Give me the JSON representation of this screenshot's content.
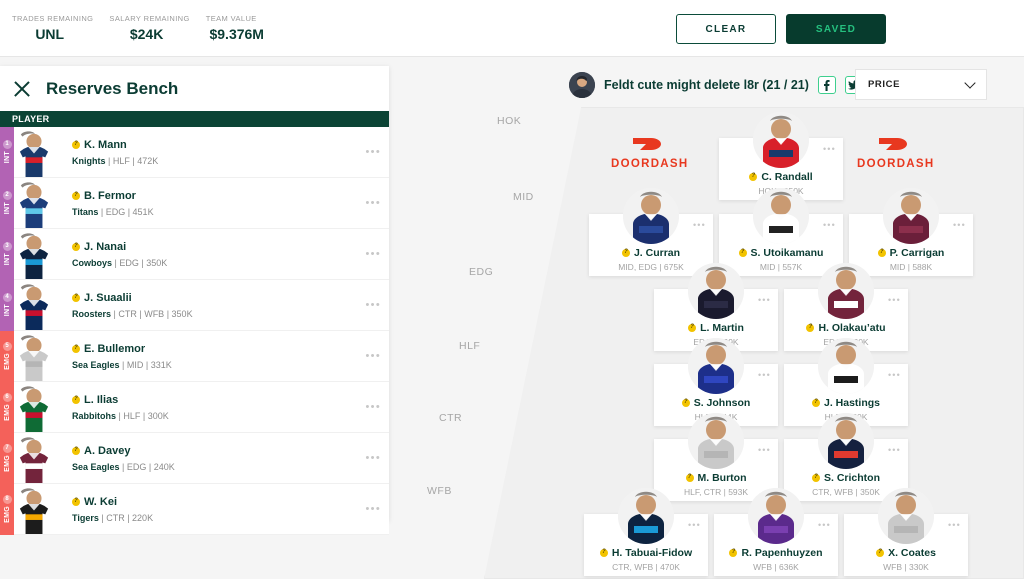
{
  "topbar": {
    "stats": [
      {
        "label": "TRADES REMAINING",
        "value": "UNL"
      },
      {
        "label": "SALARY REMAINING",
        "value": "$24K"
      },
      {
        "label": "TEAM VALUE",
        "value": "$9.376M"
      }
    ],
    "clear_label": "CLEAR",
    "saved_label": "SAVED"
  },
  "panel": {
    "title": "Reserves Bench",
    "close_icon": "close-icon",
    "column_header": "PLAYER",
    "rows": [
      {
        "slot": "INT",
        "num": "1",
        "name": "K. Mann",
        "club": "Knights",
        "pos": "HLF",
        "price": "472K",
        "jersey": [
          "#1a3a6b",
          "#d8202a"
        ],
        "menu": "•••"
      },
      {
        "slot": "INT",
        "num": "2",
        "name": "B. Fermor",
        "club": "Titans",
        "pos": "EDG",
        "price": "451K",
        "jersey": [
          "#1c3d7a",
          "#5fc8e8"
        ],
        "menu": "•••"
      },
      {
        "slot": "INT",
        "num": "3",
        "name": "J. Nanai",
        "club": "Cowboys",
        "pos": "EDG",
        "price": "350K",
        "jersey": [
          "#0d2340",
          "#1a9ad6"
        ],
        "menu": "•••"
      },
      {
        "slot": "INT",
        "num": "4",
        "name": "J. Suaalii",
        "club": "Roosters",
        "pos": "CTR | WFB",
        "price": "350K",
        "jersey": [
          "#0b2a5b",
          "#c8102e"
        ],
        "menu": "•••"
      },
      {
        "slot": "EMG",
        "num": "5",
        "name": "E. Bullemor",
        "club": "Sea Eagles",
        "pos": "MID",
        "price": "331K",
        "jersey": [
          "#c9c9c9",
          "#b5b5b5"
        ],
        "menu": "•••"
      },
      {
        "slot": "EMG",
        "num": "6",
        "name": "L. Ilias",
        "club": "Rabbitohs",
        "pos": "HLF",
        "price": "300K",
        "jersey": [
          "#0f6b35",
          "#c8102e"
        ],
        "menu": "•••"
      },
      {
        "slot": "EMG",
        "num": "7",
        "name": "A. Davey",
        "club": "Sea Eagles",
        "pos": "EDG",
        "price": "240K",
        "jersey": [
          "#73243c",
          "#ffffff"
        ],
        "menu": "•••"
      },
      {
        "slot": "EMG",
        "num": "8",
        "name": "W. Kei",
        "club": "Tigers",
        "pos": "CTR",
        "price": "220K",
        "jersey": [
          "#1c1c1c",
          "#f5a800"
        ],
        "menu": "•••"
      }
    ]
  },
  "field": {
    "team_name": "Feldt cute might delete l8r (21 / 21)",
    "facebook_icon": "facebook-icon",
    "twitter_icon": "twitter-icon",
    "avatar_icon": "team-avatar",
    "sort_value": "PRICE",
    "chevron_icon": "chevron-down-icon",
    "sponsor_name": "DOORDASH",
    "position_labels": [
      "HOK",
      "MID",
      "EDG",
      "HLF",
      "CTR",
      "WFB"
    ],
    "players": [
      {
        "name": "C. Randall",
        "meta": "HOK | 350K",
        "jersey": [
          "#d8202a",
          "#1a3a6b"
        ],
        "menu": "•••"
      },
      {
        "name": "J. Curran",
        "meta": "MID, EDG | 675K",
        "jersey": [
          "#1b2f6e",
          "#2a4a9b"
        ],
        "menu": "•••"
      },
      {
        "name": "S. Utoikamanu",
        "meta": "MID | 557K",
        "jersey": [
          "#ffffff",
          "#222222"
        ],
        "menu": "•••"
      },
      {
        "name": "P. Carrigan",
        "meta": "MID | 588K",
        "jersey": [
          "#6b1f3a",
          "#8c2f4c"
        ],
        "menu": "•••"
      },
      {
        "name": "L. Martin",
        "meta": "EDG | 499K",
        "jersey": [
          "#1a1a2e",
          "#2b2b45"
        ],
        "menu": "•••"
      },
      {
        "name": "H. Olakau’atu",
        "meta": "EDG | 620K",
        "jersey": [
          "#73243c",
          "#ffffff"
        ],
        "menu": "•••"
      },
      {
        "name": "S. Johnson",
        "meta": "HLF | 544K",
        "jersey": [
          "#1d2f8a",
          "#2f46c0"
        ],
        "menu": "•••"
      },
      {
        "name": "J. Hastings",
        "meta": "HLF | 450K",
        "jersey": [
          "#ffffff",
          "#1c1c1c"
        ],
        "menu": "•••"
      },
      {
        "name": "M. Burton",
        "meta": "HLF, CTR | 593K",
        "jersey": [
          "#c9c9c9",
          "#b5b5b5"
        ],
        "menu": "•••"
      },
      {
        "name": "S. Crichton",
        "meta": "CTR, WFB | 350K",
        "jersey": [
          "#15213f",
          "#e03a2f"
        ],
        "menu": "•••"
      },
      {
        "name": "H. Tabuai-Fidow",
        "meta": "CTR, WFB | 470K",
        "jersey": [
          "#0d2340",
          "#1a9ad6"
        ],
        "menu": "•••"
      },
      {
        "name": "R. Papenhuyzen",
        "meta": "WFB | 636K",
        "jersey": [
          "#5b2a8c",
          "#7a3fb0"
        ],
        "menu": "•••"
      },
      {
        "name": "X. Coates",
        "meta": "WFB | 330K",
        "jersey": [
          "#c9c9c9",
          "#b5b5b5"
        ],
        "menu": "•••"
      }
    ]
  },
  "colors": {
    "brand_dark": "#0b3c33",
    "green_header": "#0b4435",
    "saved_green": "#25c07f",
    "int_purple": "#b263b4",
    "emg_red": "#f4615a",
    "doordash_red": "#e8381f",
    "badge_yellow": "#f2c300"
  }
}
